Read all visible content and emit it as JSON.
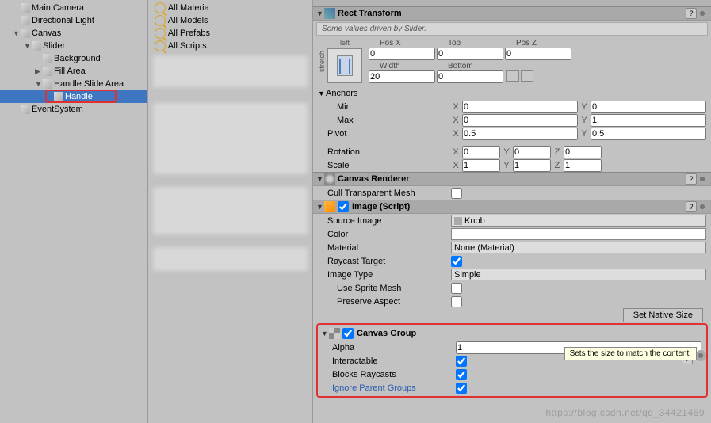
{
  "hierarchy": {
    "items": [
      {
        "label": "Main Camera",
        "depth": 1,
        "sel": false
      },
      {
        "label": "Directional Light",
        "depth": 1,
        "sel": false
      },
      {
        "label": "Canvas",
        "depth": 1,
        "sel": false,
        "fold": "▼"
      },
      {
        "label": "Slider",
        "depth": 2,
        "sel": false,
        "fold": "▼"
      },
      {
        "label": "Background",
        "depth": 3,
        "sel": false
      },
      {
        "label": "Fill Area",
        "depth": 3,
        "sel": false,
        "fold": "▶"
      },
      {
        "label": "Handle Slide Area",
        "depth": 3,
        "sel": false,
        "fold": "▼"
      },
      {
        "label": "Handle",
        "depth": 4,
        "sel": true
      },
      {
        "label": "EventSystem",
        "depth": 1,
        "sel": false
      }
    ]
  },
  "project": {
    "filters": [
      {
        "label": "All Materia"
      },
      {
        "label": "All Models"
      },
      {
        "label": "All Prefabs"
      },
      {
        "label": "All Scripts"
      }
    ]
  },
  "rect": {
    "title": "Rect Transform",
    "note": "Some values driven by Slider.",
    "anchor_h": "left",
    "head1": [
      "Pos X",
      "Top",
      "Pos Z"
    ],
    "vals1": [
      "0",
      "0",
      "0"
    ],
    "head2": [
      "Width",
      "Bottom",
      ""
    ],
    "vals2": [
      "20",
      "0",
      ""
    ],
    "anchors": "Anchors",
    "min": "Min",
    "min_x": "0",
    "min_y": "0",
    "max": "Max",
    "max_x": "0",
    "max_y": "1",
    "pivot": "Pivot",
    "pivot_x": "0.5",
    "pivot_y": "0.5",
    "rotation": "Rotation",
    "rot_x": "0",
    "rot_y": "0",
    "rot_z": "0",
    "scale": "Scale",
    "scl_x": "1",
    "scl_y": "1",
    "scl_z": "1"
  },
  "canvasRenderer": {
    "title": "Canvas Renderer",
    "cull": "Cull Transparent Mesh",
    "cull_val": false
  },
  "image": {
    "title": "Image (Script)",
    "src": "Source Image",
    "src_val": "Knob",
    "color": "Color",
    "mat": "Material",
    "mat_val": "None (Material)",
    "ray": "Raycast Target",
    "ray_val": true,
    "type": "Image Type",
    "type_val": "Simple",
    "sprite": "Use Sprite Mesh",
    "sprite_val": false,
    "preserve": "Preserve Aspect",
    "preserve_val": false,
    "setnative": "Set Native Size"
  },
  "tooltip": "Sets the size to match the content.",
  "canvasGroup": {
    "title": "Canvas Group",
    "alpha": "Alpha",
    "alpha_val": "1",
    "inter": "Interactable",
    "inter_val": true,
    "blocks": "Blocks Raycasts",
    "blocks_val": true,
    "ignore": "Ignore Parent Groups",
    "ignore_val": true
  },
  "watermark": "https://blog.csdn.net/qq_34421469"
}
